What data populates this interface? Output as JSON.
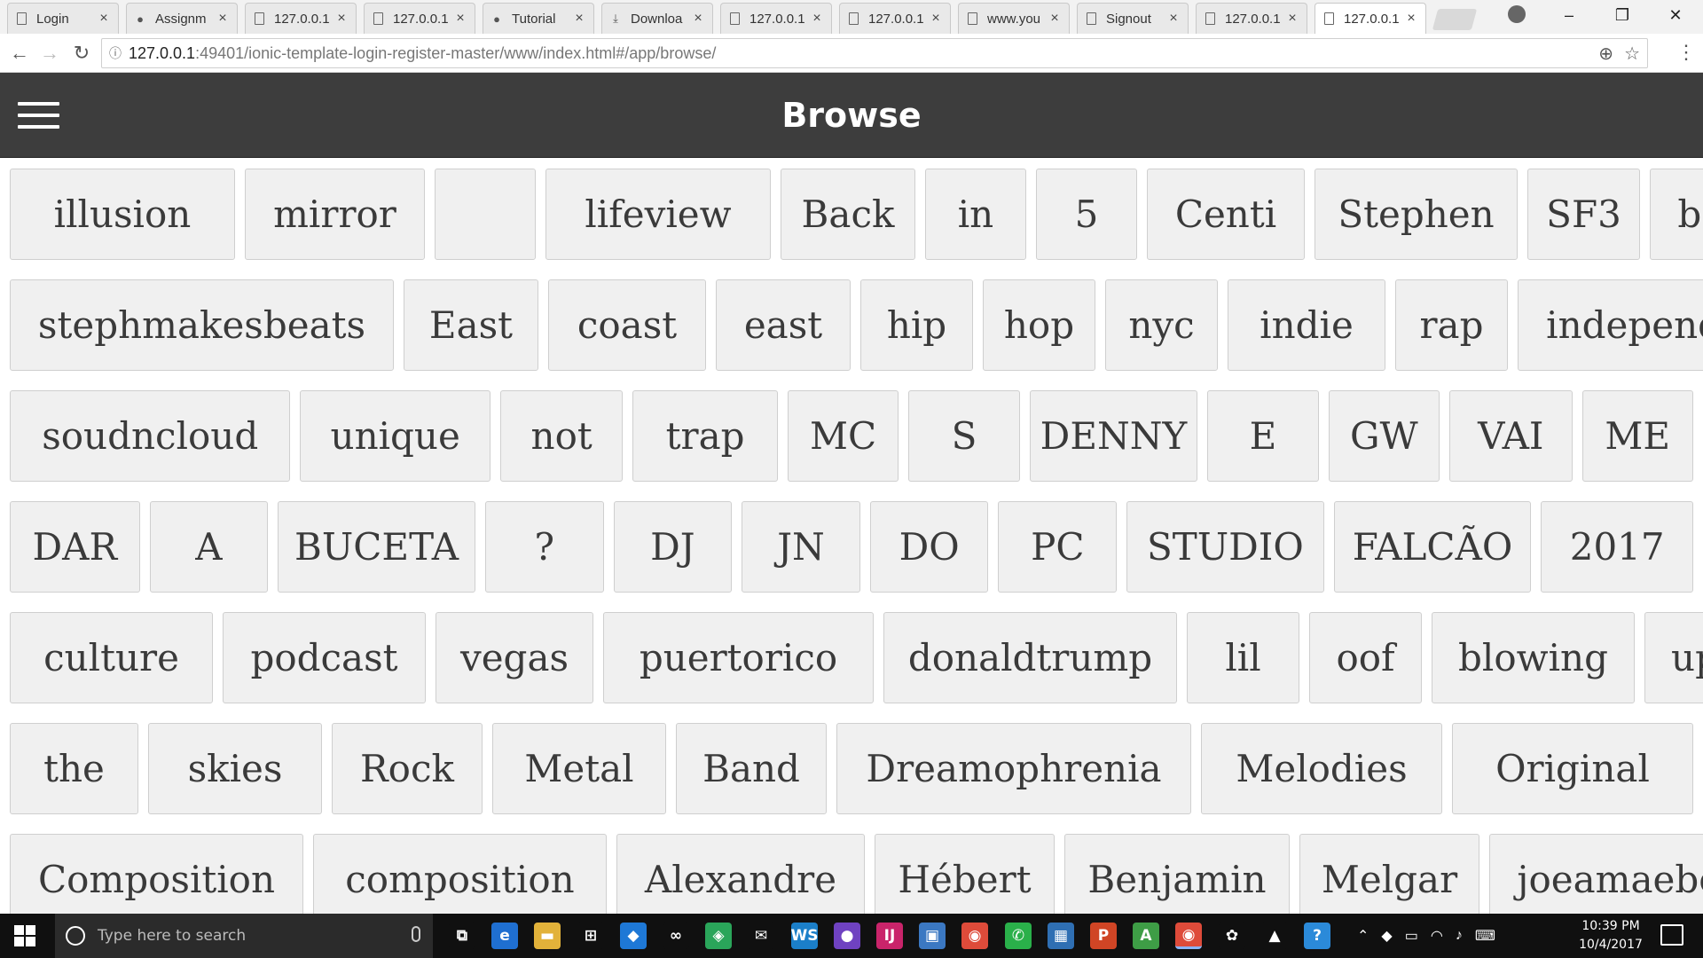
{
  "browser": {
    "tabs": [
      {
        "label": "Login",
        "icon": "page-icon"
      },
      {
        "label": "Assignm",
        "icon": "github-icon"
      },
      {
        "label": "127.0.0.1",
        "icon": "page-icon"
      },
      {
        "label": "127.0.0.1",
        "icon": "page-icon"
      },
      {
        "label": "Tutorial",
        "icon": "github-icon"
      },
      {
        "label": "Downloa",
        "icon": "download-icon"
      },
      {
        "label": "127.0.0.1",
        "icon": "page-icon"
      },
      {
        "label": "127.0.0.1",
        "icon": "page-icon"
      },
      {
        "label": "www.you",
        "icon": "page-icon"
      },
      {
        "label": "Signout",
        "icon": "page-icon"
      },
      {
        "label": "127.0.0.1",
        "icon": "page-icon"
      },
      {
        "label": "127.0.0.1",
        "icon": "page-icon"
      }
    ],
    "tab_close_glyph": "×",
    "address": {
      "host": "127.0.0.1",
      "rest": ":49401/ionic-template-login-register-master/www/index.html#/app/browse/"
    }
  },
  "app": {
    "title": "Browse",
    "header_color": "#3d3d3d"
  },
  "tags": [
    [
      "illusion",
      "mirror",
      "",
      "lifeview",
      "Back",
      "in",
      "5",
      "Centi",
      "Stephen",
      "SF3",
      "beats"
    ],
    [
      "stephmakesbeats",
      "East",
      "coast",
      "east",
      "hip",
      "hop",
      "nyc",
      "indie",
      "rap",
      "independent"
    ],
    [
      "soudncloud",
      "unique",
      "not",
      "trap",
      "MC",
      "S",
      "DENNY",
      "E",
      "GW",
      "VAI",
      "ME"
    ],
    [
      "DAR",
      "A",
      "BUCETA",
      "?",
      "DJ",
      "JN",
      "DO",
      "PC",
      "STUDIO",
      "FALCÃO",
      "2017"
    ],
    [
      "culture",
      "podcast",
      "vegas",
      "puertorico",
      "donaldtrump",
      "lil",
      "oof",
      "blowing",
      "up"
    ],
    [
      "the",
      "skies",
      "Rock",
      "Metal",
      "Band",
      "Dreamophrenia",
      "Melodies",
      "Original"
    ],
    [
      "Composition",
      "composition",
      "Alexandre",
      "Hébert",
      "Benjamin",
      "Melgar",
      "joeamaebeats"
    ]
  ],
  "taskbar": {
    "search_placeholder": "Type here to search",
    "time": "10:39 PM",
    "date": "10/4/2017",
    "apps": [
      {
        "name": "task-view-icon",
        "glyph": "⧉",
        "color": "#101010"
      },
      {
        "name": "edge-icon",
        "glyph": "e",
        "color": "#1f6fd1"
      },
      {
        "name": "file-explorer-icon",
        "glyph": "▬",
        "color": "#e2b23a"
      },
      {
        "name": "store-icon",
        "glyph": "⊞",
        "color": "#101010"
      },
      {
        "name": "dropbox-icon",
        "glyph": "◆",
        "color": "#1e78d6"
      },
      {
        "name": "arduino-icon",
        "glyph": "∞",
        "color": "#101010"
      },
      {
        "name": "sourcetree-icon",
        "glyph": "◈",
        "color": "#2aa55a"
      },
      {
        "name": "mail-icon",
        "glyph": "✉",
        "color": "#101010"
      },
      {
        "name": "webstorm-icon",
        "glyph": "WS",
        "color": "#1b7fc9"
      },
      {
        "name": "github-desktop-icon",
        "glyph": "●",
        "color": "#6f42c1"
      },
      {
        "name": "intellij-icon",
        "glyph": "IJ",
        "color": "#c9246a"
      },
      {
        "name": "virtualbox-icon",
        "glyph": "▣",
        "color": "#3b78c2"
      },
      {
        "name": "chrome-icon",
        "glyph": "◉",
        "color": "#de4b3a"
      },
      {
        "name": "whatsapp-icon",
        "glyph": "✆",
        "color": "#2ab04a"
      },
      {
        "name": "app-icon",
        "glyph": "▦",
        "color": "#2f6fb3"
      },
      {
        "name": "powerpoint-icon",
        "glyph": "P",
        "color": "#d04525"
      },
      {
        "name": "android-studio-icon",
        "glyph": "A",
        "color": "#3e9d46"
      },
      {
        "name": "chrome-active-icon",
        "glyph": "◉",
        "color": "#de4b3a"
      },
      {
        "name": "paint-icon",
        "glyph": "✿",
        "color": "#101010"
      },
      {
        "name": "photos-icon",
        "glyph": "▲",
        "color": "#101010"
      },
      {
        "name": "help-icon",
        "glyph": "?",
        "color": "#2b8ad9"
      }
    ]
  }
}
